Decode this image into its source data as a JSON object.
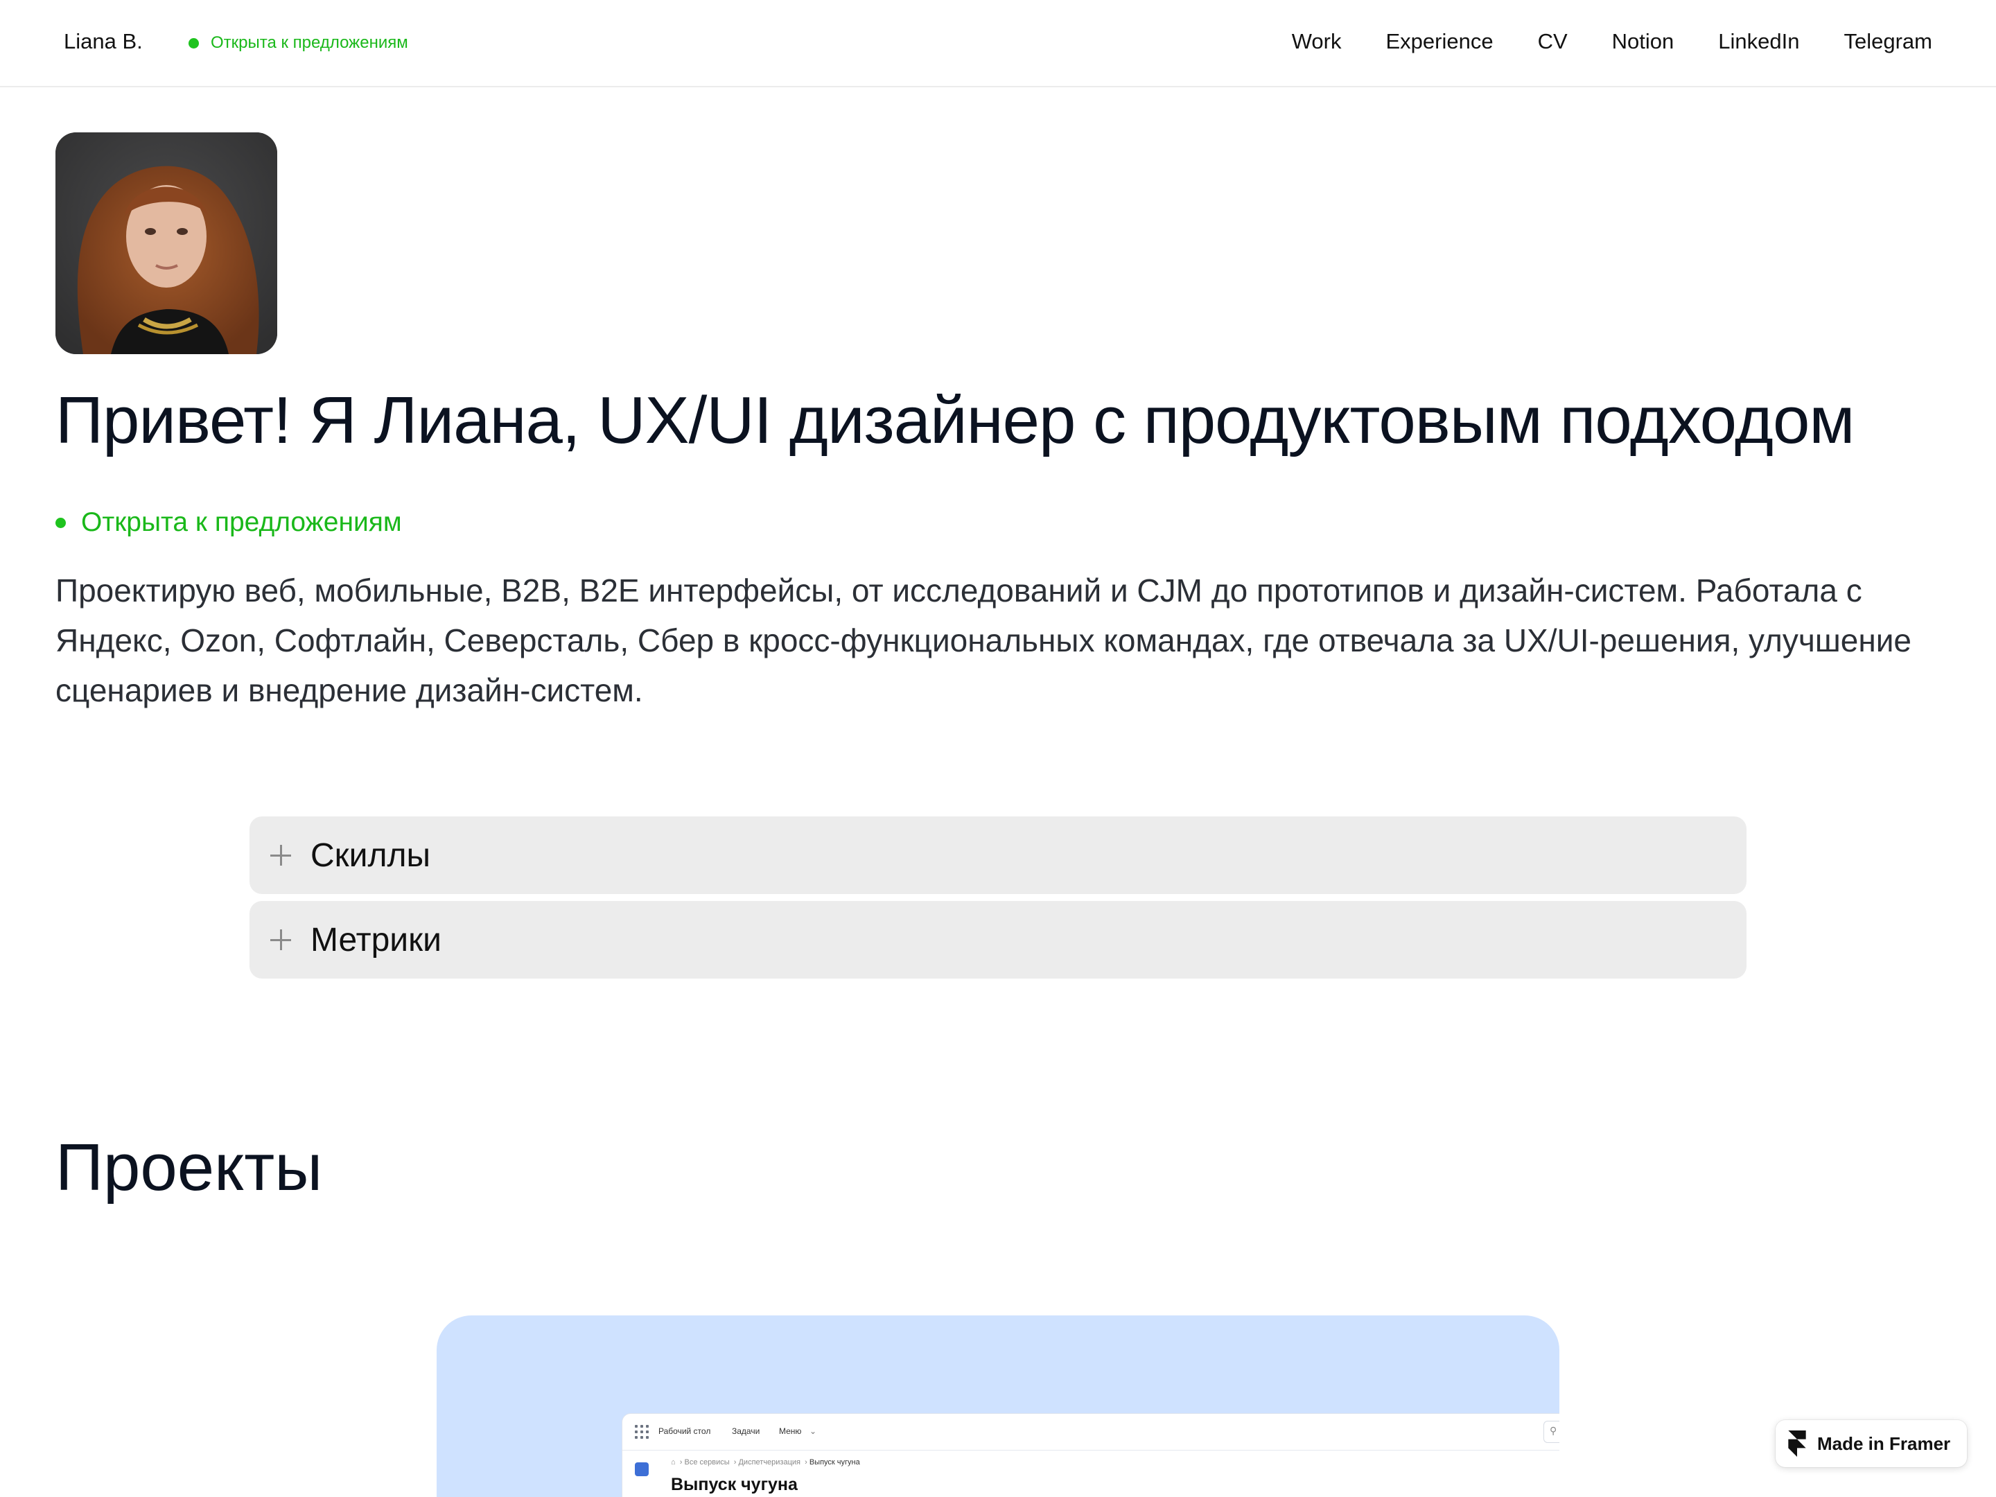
{
  "header": {
    "brand": "Liana B.",
    "status": "Открыта к предложениям",
    "nav": [
      "Work",
      "Experience",
      "CV",
      "Notion",
      "LinkedIn",
      "Telegram"
    ]
  },
  "hero": {
    "title": "Привет! Я Лиана, UX/UI дизайнер с продуктовым подходом",
    "status": "Открыта к предложениям",
    "intro": "Проектирую веб, мобильные, B2B, B2E интерфейсы, от исследований и CJM до прототипов и дизайн-систем. Работала с Яндекс, Ozon, Софтлайн, Северсталь, Сбер в кросс-функциональных командах, где отвечала за UX/UI-решения, улучшение сценариев и внедрение дизайн-систем."
  },
  "accordion": [
    {
      "label": "Скиллы",
      "icon": "plus-icon"
    },
    {
      "label": "Метрики",
      "icon": "plus-icon"
    }
  ],
  "projects": {
    "title": "Проекты",
    "card": {
      "nav": [
        "Рабочий стол",
        "Задачи",
        "Меню"
      ],
      "breadcrumbs": [
        "Все сервисы",
        "Диспетчеризация",
        "Выпуск чугуна"
      ],
      "title": "Выпуск чугуна"
    }
  },
  "badge": {
    "label": "Made in Framer",
    "icon": "framer-logo-icon"
  },
  "colors": {
    "status_green": "#1ec31e",
    "accordion_bg": "#ececec",
    "project_card_bg": "#cfe2ff",
    "text_dark": "#0b1220"
  }
}
